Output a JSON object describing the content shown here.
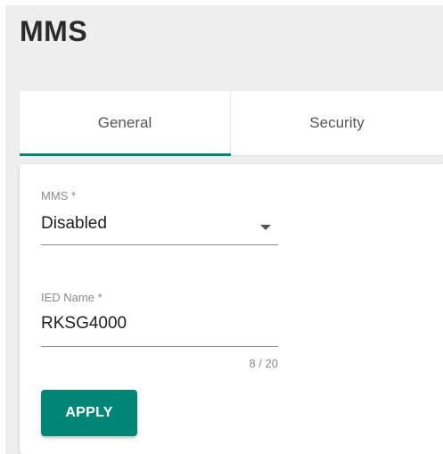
{
  "page": {
    "title": "MMS"
  },
  "tabs": [
    {
      "label": "General",
      "active": true
    },
    {
      "label": "Security",
      "active": false
    }
  ],
  "form": {
    "mms": {
      "label": "MMS *",
      "value": "Disabled"
    },
    "ied_name": {
      "label": "IED Name *",
      "value": "RKSG4000",
      "counter": "8 / 20"
    },
    "apply_label": "APPLY"
  },
  "colors": {
    "accent": "#008577",
    "background": "#eeeeee",
    "card": "#ffffff"
  },
  "icons": {
    "mms_dropdown": "dropdown-arrow-icon"
  }
}
